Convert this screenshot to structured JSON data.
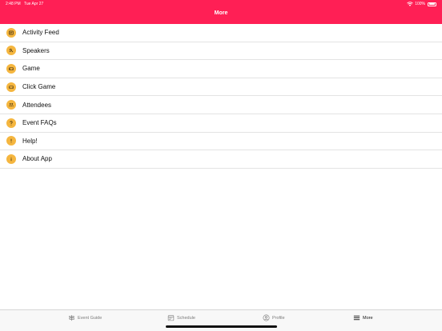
{
  "status": {
    "time": "2:48 PM",
    "date": "Tue Apr 27",
    "battery": "100%"
  },
  "header": {
    "title": "More",
    "color": "#ff1f55"
  },
  "menu": [
    {
      "label": "Activity Feed",
      "icon": "activity-feed-icon"
    },
    {
      "label": "Speakers",
      "icon": "speakers-icon"
    },
    {
      "label": "Game",
      "icon": "game-icon"
    },
    {
      "label": "Click Game",
      "icon": "click-game-icon"
    },
    {
      "label": "Attendees",
      "icon": "attendees-icon"
    },
    {
      "label": "Event FAQs",
      "icon": "question-icon"
    },
    {
      "label": "Help!",
      "icon": "exclamation-icon"
    },
    {
      "label": "About App",
      "icon": "info-icon"
    }
  ],
  "accent_icon_color": "#f5b63f",
  "tabs": [
    {
      "label": "Event Guide",
      "icon": "signpost-icon"
    },
    {
      "label": "Schedule",
      "icon": "calendar-icon"
    },
    {
      "label": "Profile",
      "icon": "person-icon"
    },
    {
      "label": "More",
      "icon": "menu-icon",
      "selected": true
    }
  ]
}
